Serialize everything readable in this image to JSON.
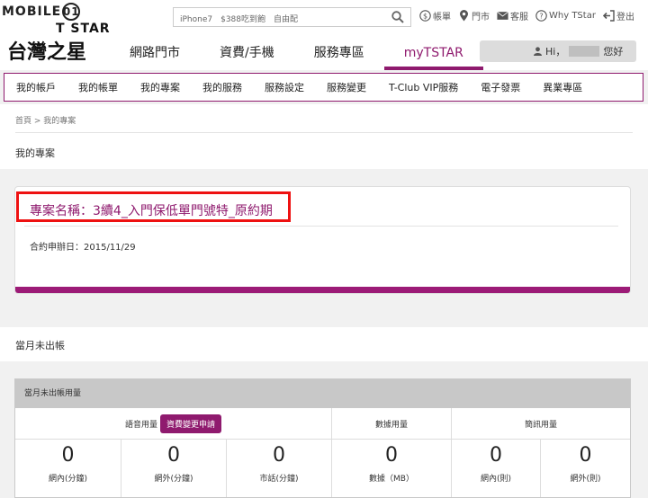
{
  "watermark": {
    "text": "MOBILE",
    "badge": "01"
  },
  "logo": {
    "top": "T STAR",
    "main": "台灣之星"
  },
  "search": {
    "hint": "iPhone7　$388吃到飽　自由配"
  },
  "top_links": [
    {
      "icon": "dollar-icon",
      "label": "帳單"
    },
    {
      "icon": "map-pin-icon",
      "label": "門市"
    },
    {
      "icon": "mail-icon",
      "label": "客服"
    },
    {
      "icon": "help-icon",
      "label": "Why TStar"
    },
    {
      "icon": "logout-icon",
      "label": "登出"
    }
  ],
  "main_nav": [
    {
      "label": "網路門市",
      "active": false
    },
    {
      "label": "資費/手機",
      "active": false
    },
    {
      "label": "服務專區",
      "active": false
    },
    {
      "label": "myTSTAR",
      "active": true
    }
  ],
  "user": {
    "greeting_prefix": "Hi，",
    "greeting_suffix": "您好"
  },
  "sub_nav": [
    "我的帳戶",
    "我的帳單",
    "我的專案",
    "我的服務",
    "服務設定",
    "服務變更",
    "T-Club VIP服務",
    "電子發票",
    "異業專區"
  ],
  "breadcrumb": "首頁 > 我的專案",
  "page_title": "我的專案",
  "plan": {
    "name": "專案名稱：3續4_入門保低單門號特_原約期",
    "contract_date": "合約申辦日：2015/11/29"
  },
  "unbilled": {
    "section_title": "當月未出帳",
    "table_title": "當月未出帳用量",
    "groups": {
      "voice": "語音用量",
      "voice_button": "資費變更申請",
      "data": "數據用量",
      "sms": "簡訊用量"
    },
    "cells": [
      {
        "value": "0",
        "label": "網內(分鐘)"
      },
      {
        "value": "0",
        "label": "網外(分鐘)"
      },
      {
        "value": "0",
        "label": "市話(分鐘)"
      },
      {
        "value": "0",
        "label": "數據（MB）"
      },
      {
        "value": "0",
        "label": "網內(則)"
      },
      {
        "value": "0",
        "label": "網外(則)"
      }
    ]
  },
  "colors": {
    "brand": "#8f1a6e",
    "highlight": "#e11111"
  }
}
